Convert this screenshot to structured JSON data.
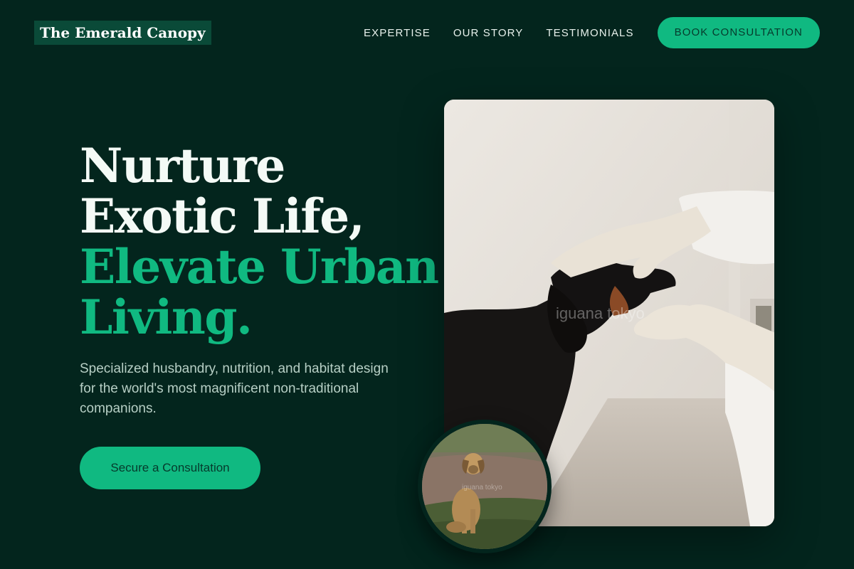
{
  "header": {
    "logo": "The Emerald Canopy",
    "nav": [
      "EXPERTISE",
      "OUR STORY",
      "TESTIMONIALS"
    ],
    "cta": "BOOK CONSULTATION"
  },
  "hero": {
    "title_white_1": "Nurture",
    "title_white_2": "Exotic Life,",
    "title_green_1": "Elevate Urban",
    "title_green_2": "Living.",
    "subtitle": "Specialized husbandry, nutrition, and habitat design for the world's most magnificent non-traditional companions.",
    "button": "Secure a Consultation"
  },
  "images": {
    "main_watermark": "iguana tokyo",
    "round_watermark": "iguana tokyo"
  },
  "colors": {
    "background": "#03251d",
    "accent": "#10b981",
    "logo_bg": "#0a4a38"
  }
}
